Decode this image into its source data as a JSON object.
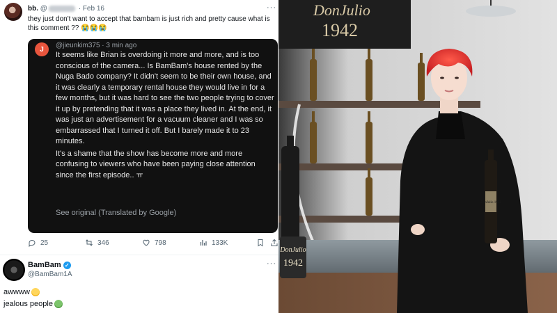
{
  "tweet": {
    "name": "bb.",
    "handle_prefix": "@",
    "date": "· Feb 16",
    "more": "···",
    "text": "they just don't want to accept that bambam is just rich and pretty cause what is this comment ?? 😭😭😭"
  },
  "comment": {
    "avatar_letter": "J",
    "meta": "@jieunkim375 · 3 min ago",
    "paragraph1": "It seems like Brian is overdoing it more and more, and is too conscious of the camera... Is BamBam's house rented by the Nuga Bado company? It didn't seem to be their own house, and it was clearly a temporary rental house they would live in for a few months, but it was hard to see the two people trying to cover it up by pretending that it was a place they lived in. At the end, it was just an advertisement for a vacuum cleaner and I was so embarrassed that I turned it off. But I barely made it to 23 minutes.",
    "paragraph2": "It's a shame that the show has become more and more confusing to viewers who have been paying close attention since the first episode.. ㅠ",
    "see_original": "See original (Translated by Google)"
  },
  "actions": {
    "replies": "25",
    "retweets": "346",
    "likes": "798",
    "views": "133K"
  },
  "reply": {
    "name": "BamBam",
    "handle": "@BamBam1A",
    "more": "···",
    "line1": "awwww",
    "line2": "jealous people"
  },
  "photo": {
    "sign_brand": "DonJulio",
    "sign_year": "1942",
    "bottle_brand": "DonJulio",
    "bottle_year": "1942",
    "held_bottle_label": "DonJulio 1942"
  },
  "colors": {
    "card_bg": "#111111",
    "verified": "#1d9bf0",
    "hair": "#e8302f",
    "coat": "#141414"
  }
}
